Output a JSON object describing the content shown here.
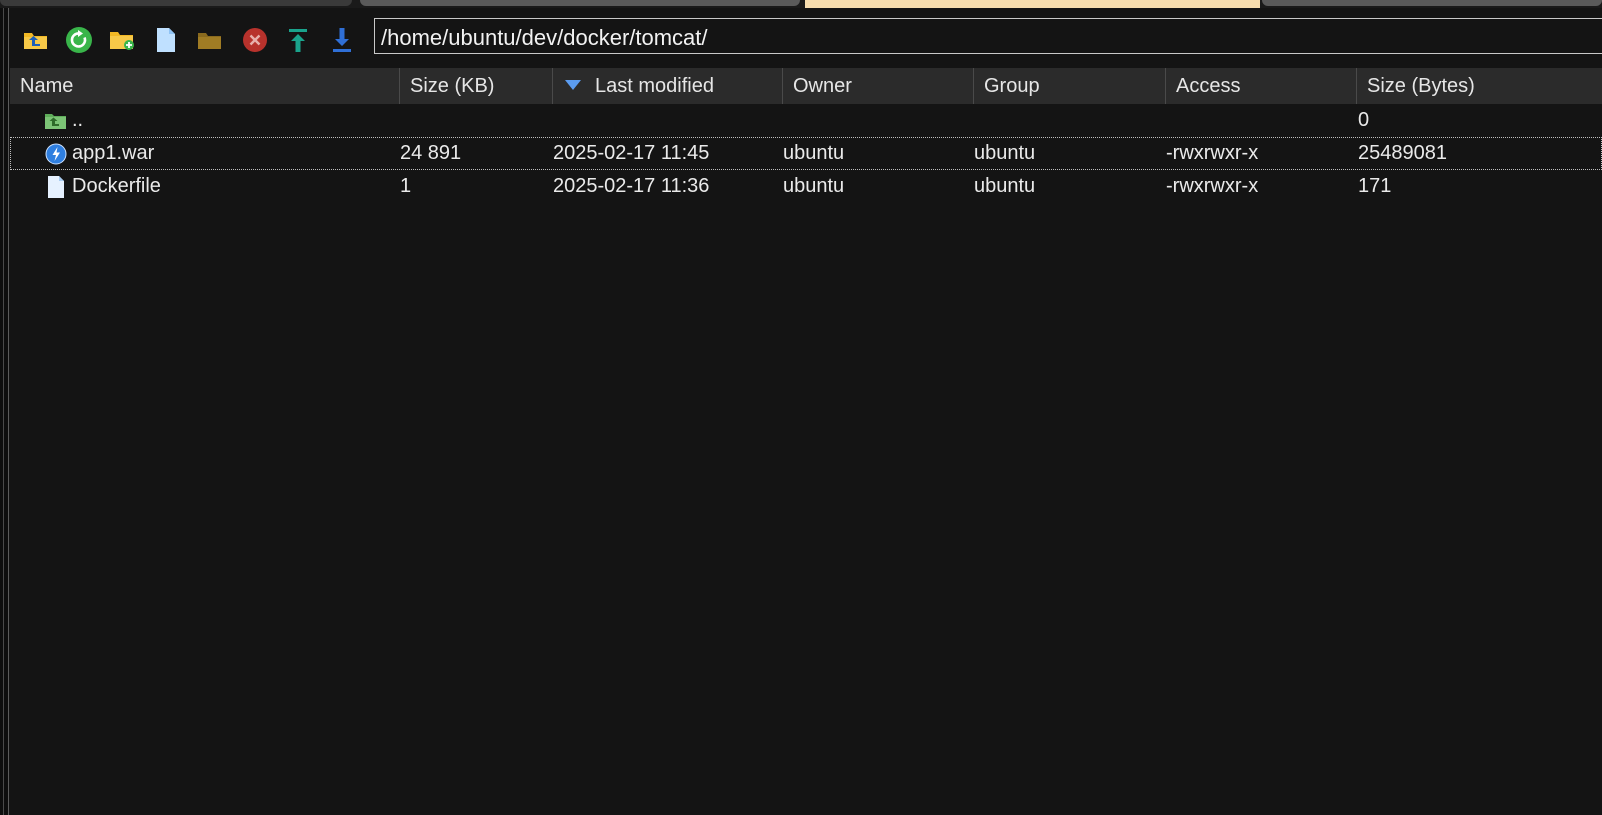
{
  "toolbar": {
    "buttons": [
      {
        "name": "parent-folder-icon",
        "title": "Parent directory"
      },
      {
        "name": "refresh-icon",
        "title": "Refresh"
      },
      {
        "name": "new-folder-icon",
        "title": "Create directory"
      },
      {
        "name": "new-file-icon",
        "title": "New file"
      },
      {
        "name": "folder-icon",
        "title": "Open folder"
      },
      {
        "name": "delete-icon",
        "title": "Delete"
      },
      {
        "name": "upload-icon",
        "title": "Upload"
      },
      {
        "name": "download-icon",
        "title": "Download"
      }
    ],
    "path": "/home/ubuntu/dev/docker/tomcat/"
  },
  "table": {
    "columns": {
      "name": "Name",
      "size_kb": "Size (KB)",
      "last_modified": "Last modified",
      "owner": "Owner",
      "group": "Group",
      "access": "Access",
      "size_bytes": "Size (Bytes)"
    },
    "sort": {
      "column": "last_modified",
      "direction": "descending"
    },
    "rows": [
      {
        "icon": "parent-folder-icon",
        "name": "..",
        "size_kb": "",
        "last_modified": "",
        "owner": "",
        "group": "",
        "access": "",
        "size_bytes": "0"
      },
      {
        "icon": "war-file-icon",
        "name": "app1.war",
        "size_kb": "24 891",
        "last_modified": "2025-02-17 11:45",
        "owner": "ubuntu",
        "group": "ubuntu",
        "access": "-rwxrwxr-x",
        "size_bytes": "25489081",
        "selected": true
      },
      {
        "icon": "file-icon",
        "name": "Dockerfile",
        "size_kb": "1",
        "last_modified": "2025-02-17 11:36",
        "owner": "ubuntu",
        "group": "ubuntu",
        "access": "-rwxrwxr-x",
        "size_bytes": "171"
      }
    ]
  },
  "colors": {
    "background": "#141414",
    "header": "#2b2b2b",
    "sort_arrow": "#5b9cf0",
    "folder": "#f2b824",
    "refresh": "#39b54a",
    "delete": "#b8322c",
    "upload": "#1aa38c",
    "download": "#2f6fd6"
  }
}
